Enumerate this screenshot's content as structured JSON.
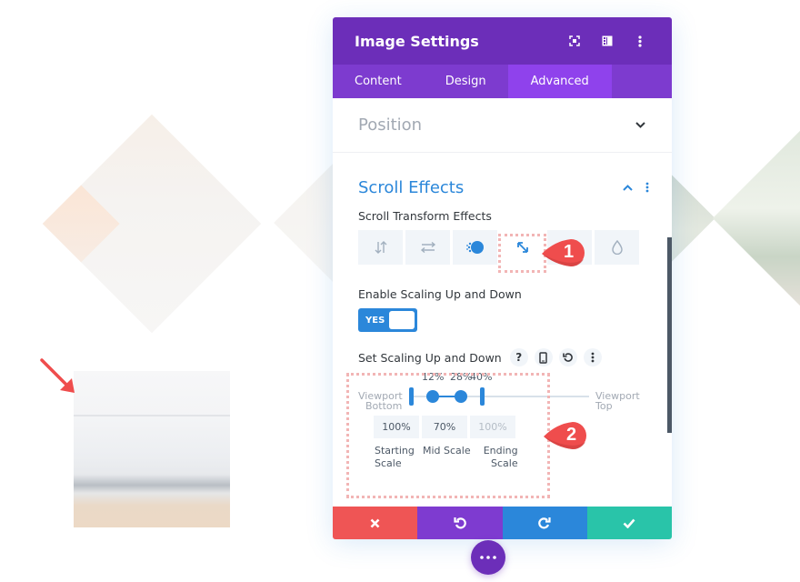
{
  "panel": {
    "title": "Image Settings",
    "header_icons": [
      "expand-icon",
      "split-view-icon",
      "more-vertical-icon"
    ],
    "tabs": [
      {
        "label": "Content",
        "active": false
      },
      {
        "label": "Design",
        "active": false
      },
      {
        "label": "Advanced",
        "active": true
      }
    ],
    "sections": {
      "position": {
        "title": "Position",
        "expanded": false
      },
      "scroll_effects": {
        "title": "Scroll Effects",
        "expanded": true,
        "transform_label": "Scroll Transform Effects",
        "effect_icons": [
          "vertical-motion-icon",
          "horizontal-motion-icon",
          "fading-icon",
          "scaling-icon",
          "rotating-icon",
          "blur-icon"
        ],
        "selected_effect": "scaling-icon",
        "enable_label": "Enable Scaling Up and Down",
        "toggle": {
          "label": "YES",
          "on": true
        },
        "set_label": "Set Scaling Up and Down",
        "set_icons": [
          "help-icon",
          "mobile-icon",
          "reset-icon",
          "more-vertical-icon"
        ],
        "slider": {
          "left_label_1": "Viewport",
          "left_label_2": "Bottom",
          "right_label_1": "Viewport",
          "right_label_2": "Top",
          "markers": [
            "12%",
            "28%",
            "40%"
          ],
          "start_pct": 0,
          "mid_start_pct": 12,
          "mid_end_pct": 28,
          "end_pct": 40
        },
        "inputs": [
          {
            "value": "100%",
            "label_1": "Starting",
            "label_2": "Scale",
            "disabled": false
          },
          {
            "value": "70%",
            "label_1": "Mid Scale",
            "label_2": "",
            "disabled": false
          },
          {
            "value": "100%",
            "label_1": "Ending",
            "label_2": "Scale",
            "disabled": true
          }
        ]
      }
    },
    "footer": [
      {
        "name": "cancel",
        "icon": "close-icon",
        "color": "#ef5555"
      },
      {
        "name": "undo",
        "icon": "undo-icon",
        "color": "#7e3bd0"
      },
      {
        "name": "redo",
        "icon": "redo-icon",
        "color": "#2b87da"
      },
      {
        "name": "save",
        "icon": "check-icon",
        "color": "#29c4a9"
      }
    ]
  },
  "callouts": [
    "1",
    "2"
  ],
  "colors": {
    "header": "#6c2eb9",
    "tabs": "#7d3bcf",
    "active_tab": "#8f42ec",
    "accent": "#2b87da",
    "callout": "#ef4d4d"
  }
}
